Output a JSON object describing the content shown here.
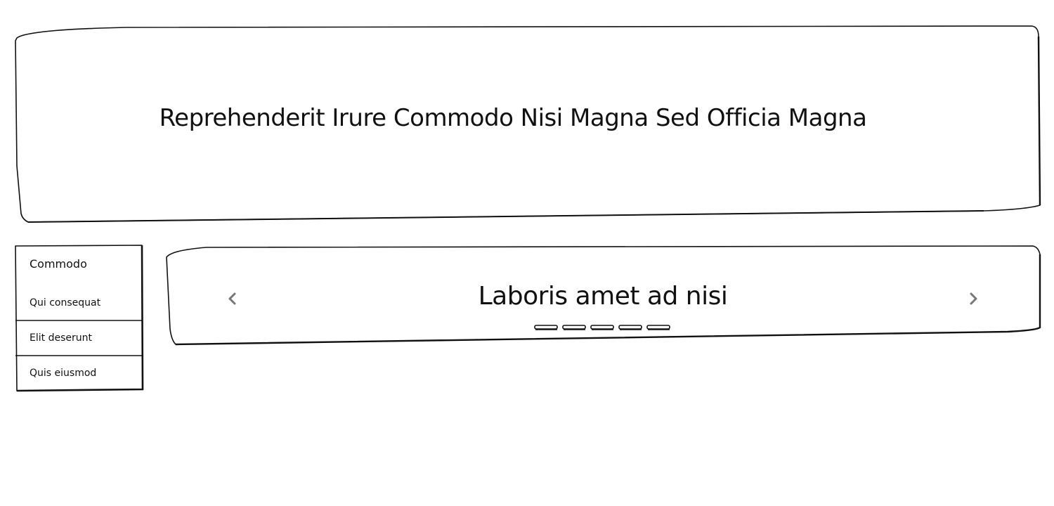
{
  "hero": {
    "title": "Reprehenderit Irure Commodo Nisi Magna Sed Officia Magna"
  },
  "sidebar": {
    "header": "Commodo",
    "items": [
      {
        "label": "Qui consequat"
      },
      {
        "label": "Elit deserunt"
      },
      {
        "label": "Quis eiusmod"
      }
    ]
  },
  "carousel": {
    "title": "Laboris amet ad nisi",
    "prev_icon": "chevron-left-icon",
    "next_icon": "chevron-right-icon",
    "indicator_count": 5
  },
  "colors": {
    "stroke": "#111111",
    "arrow": "#777777",
    "background": "#ffffff"
  }
}
